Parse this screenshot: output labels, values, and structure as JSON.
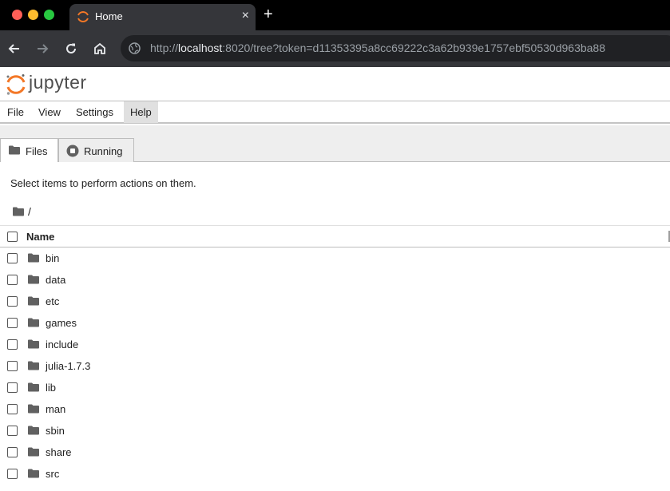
{
  "browser": {
    "tab_title": "Home",
    "close_glyph": "×",
    "newtab_glyph": "+",
    "url_scheme": "http://",
    "url_host": "localhost",
    "url_rest": ":8020/tree?token=d11353395a8cc69222c3a62b939e1757ebf50530d963ba88"
  },
  "app": {
    "logo_text": "jupyter",
    "brand_color": "#f37726"
  },
  "menu": {
    "items": [
      "File",
      "View",
      "Settings",
      "Help"
    ],
    "active": "Help"
  },
  "tabs": {
    "files": "Files",
    "running": "Running"
  },
  "main": {
    "hint": "Select items to perform actions on them.",
    "breadcrumb": "/",
    "column_name": "Name",
    "files": [
      "bin",
      "data",
      "etc",
      "games",
      "include",
      "julia-1.7.3",
      "lib",
      "man",
      "sbin",
      "share",
      "src"
    ]
  },
  "icons": {
    "folder": "folder-icon",
    "running": "stop-circle-icon"
  }
}
